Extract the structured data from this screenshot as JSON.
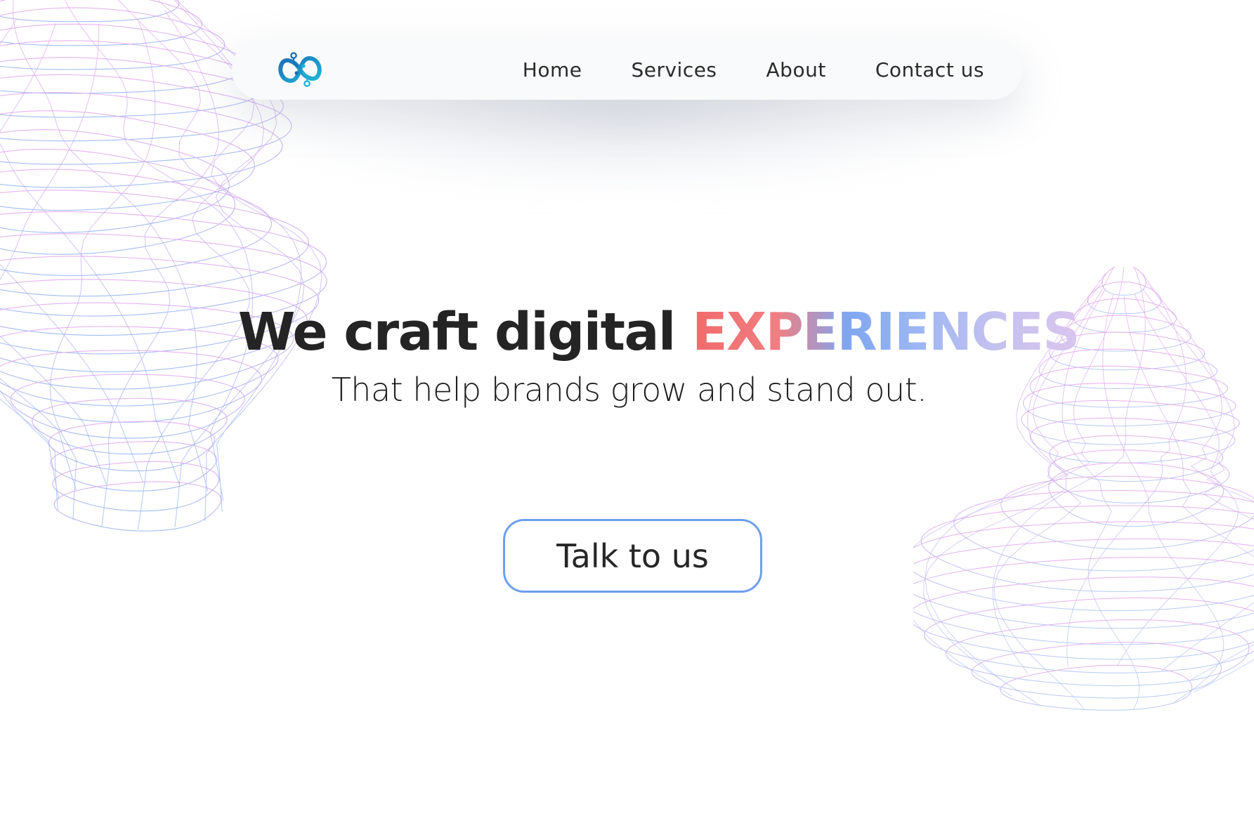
{
  "nav": {
    "logo_icon": "infinity-circuit-logo-icon",
    "links": [
      {
        "label": "Home"
      },
      {
        "label": "Services"
      },
      {
        "label": "About"
      },
      {
        "label": "Contact us"
      }
    ]
  },
  "hero": {
    "title_prefix": "We craft digital ",
    "title_accent": "EXPERIENCES",
    "subtitle": "That help brands grow and stand out.",
    "cta_label": "Talk to us"
  },
  "colors": {
    "text": "#242424",
    "cta_border": "#6e9ef0",
    "accent_gradient": [
      "#f06b6b",
      "#7fa6f0",
      "#d9c5ee"
    ],
    "logo_primary": "#1b8fd1",
    "logo_secondary": "#20b6d8",
    "wireframe_pink": "#e2a6ee",
    "wireframe_blue": "#8fb2f0"
  }
}
